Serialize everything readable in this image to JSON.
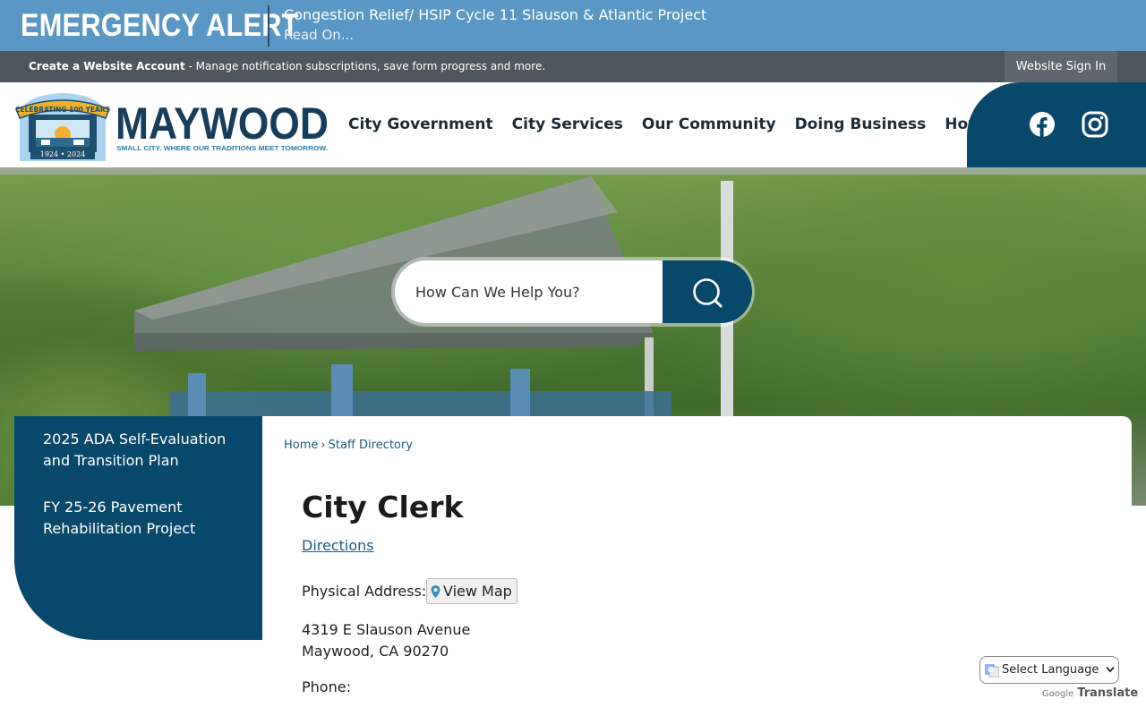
{
  "alert": {
    "label": "EMERGENCY ALERT",
    "headline": "Congestion Relief/ HSIP Cycle 11 Slauson & Atlantic Project",
    "read_on": "Read On..."
  },
  "account_bar": {
    "create_link": "Create a Website Account",
    "description": " - Manage notification subscriptions, save form progress and more.",
    "signin": "Website Sign In"
  },
  "logo": {
    "name": "MAYWOOD",
    "tagline": "SMALL CITY. WHERE OUR TRADITIONS MEET TOMORROW.",
    "badge_top": "CELEBRATING 100 YEARS",
    "badge_years": "1924 • 2024"
  },
  "nav": {
    "items": [
      {
        "label": "City Government"
      },
      {
        "label": "City Services"
      },
      {
        "label": "Our Community"
      },
      {
        "label": "Doing Business"
      },
      {
        "label": "How Do I..."
      }
    ]
  },
  "social": {
    "icons": [
      "facebook-icon",
      "instagram-icon"
    ],
    "panel_color": "#08486b"
  },
  "search": {
    "placeholder": "How Can We Help You?"
  },
  "sidebar": {
    "links": [
      {
        "label": "2025 ADA Self-Evaluation and Transition Plan"
      },
      {
        "label": "FY 25-26 Pavement Rehabilitation Project"
      }
    ]
  },
  "breadcrumb": {
    "home": "Home",
    "separator": "›",
    "current": "Staff Directory"
  },
  "page": {
    "title": "City Clerk",
    "directions": "Directions",
    "address_label": "Physical Address:",
    "view_map": "View Map",
    "address_line1": "4319 E Slauson Avenue",
    "address_line2": "Maywood, CA 90270",
    "phone_label": "Phone:"
  },
  "translate": {
    "select_label": "Select Language",
    "powered_by": "Google",
    "translate_text": "Translate"
  },
  "colors": {
    "alert_bg": "#5b97c4",
    "brand_dark": "#08486b",
    "account_bar_bg": "#50565d"
  }
}
